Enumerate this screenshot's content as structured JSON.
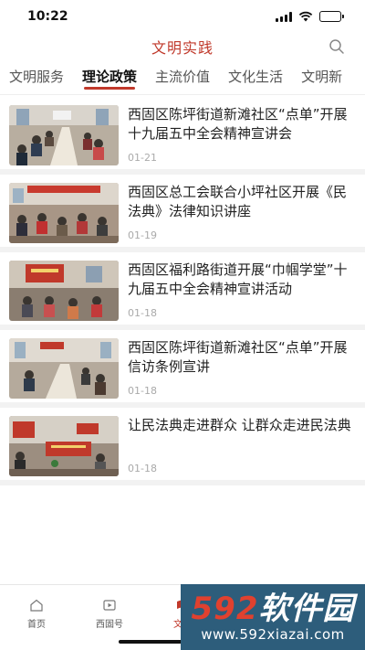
{
  "status_bar": {
    "time": "10:22"
  },
  "header": {
    "title": "文明实践"
  },
  "tabs": [
    {
      "label": "文明服务"
    },
    {
      "label": "理论政策"
    },
    {
      "label": "主流价值"
    },
    {
      "label": "文化生活"
    },
    {
      "label": "文明新"
    }
  ],
  "active_tab": "理论政策",
  "articles": [
    {
      "title": "西固区陈坪街道新滩社区“点单”开展十九届五中全会精神宣讲会",
      "date": "01-21"
    },
    {
      "title": "西固区总工会联合小坪社区开展《民法典》法律知识讲座",
      "date": "01-19"
    },
    {
      "title": "西固区福利路街道开展“巾帼学堂”十九届五中全会精神宣讲活动",
      "date": "01-18"
    },
    {
      "title": "西固区陈坪街道新滩社区“点单”开展信访条例宣讲",
      "date": "01-18"
    },
    {
      "title": "让民法典走进群众 让群众走进民法典",
      "date": "01-18"
    }
  ],
  "bottom_nav": [
    {
      "label": "首页",
      "icon": "home-icon"
    },
    {
      "label": "西固号",
      "icon": "play-icon"
    },
    {
      "label": "文明",
      "icon": "flag-icon"
    }
  ],
  "watermark": {
    "logo_num": "592",
    "logo_text": "软件园",
    "url": "www.592xiazai.com"
  },
  "colors": {
    "accent": "#c0392b",
    "watermark_bg": "#2d5d7b",
    "watermark_red": "#e0412f"
  }
}
